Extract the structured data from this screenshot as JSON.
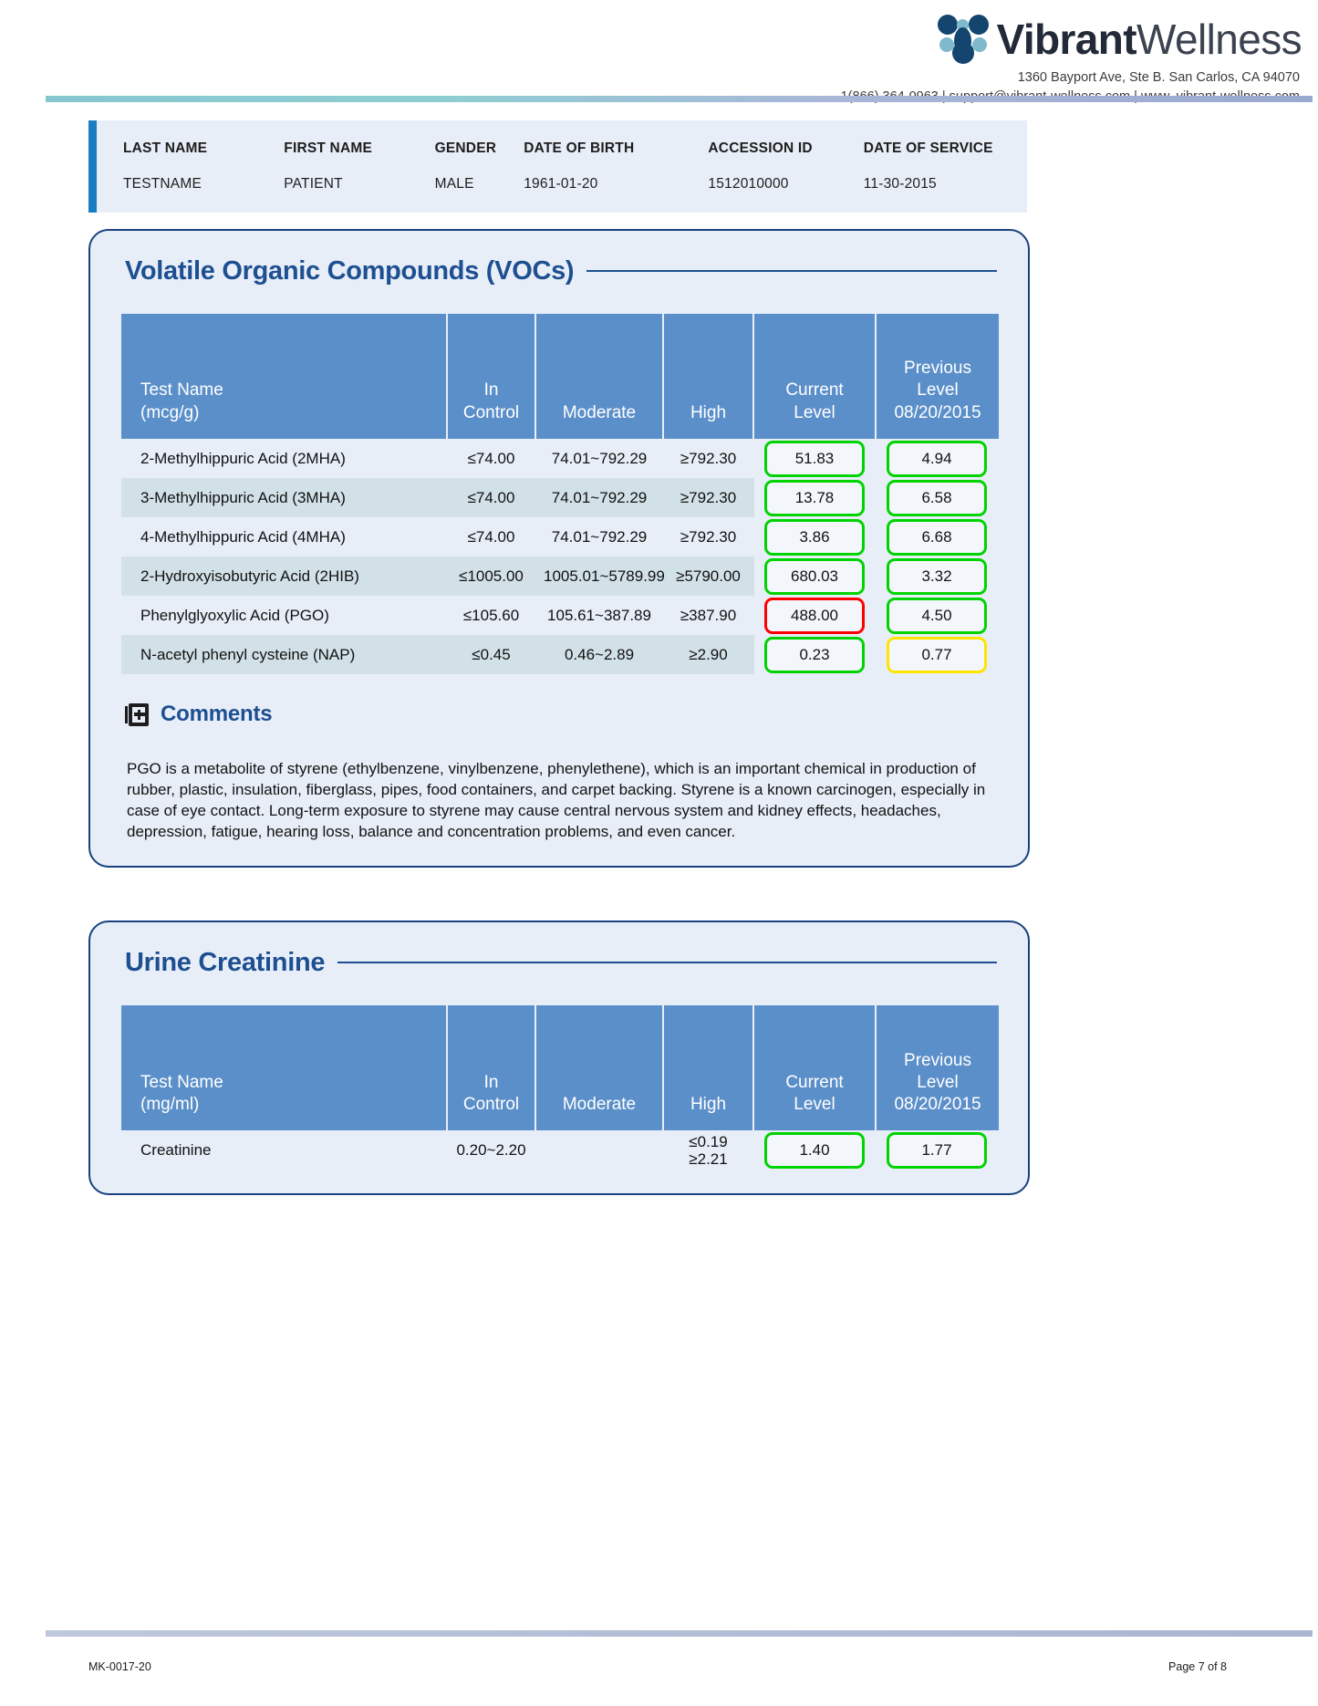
{
  "header": {
    "brand_bold": "Vibrant",
    "brand_light": "Wellness",
    "address_line1": "1360 Bayport Ave, Ste B. San Carlos, CA 94070",
    "address_line2": "1(866) 364-0963 | support@vibrant-wellness.com | www. vibrant-wellness.com"
  },
  "patient": {
    "labels": {
      "last_name": "LAST NAME",
      "first_name": "FIRST NAME",
      "gender": "GENDER",
      "dob": "DATE OF BIRTH",
      "accession_id": "ACCESSION ID",
      "date_of_service": "DATE OF SERVICE"
    },
    "values": {
      "last_name": "TESTNAME",
      "first_name": "PATIENT",
      "gender": "MALE",
      "dob": "1961-01-20",
      "accession_id": "1512010000",
      "date_of_service": "11-30-2015"
    }
  },
  "vocs": {
    "title": "Volatile Organic Compounds (VOCs)",
    "columns": {
      "name_line1": "Test Name",
      "name_line2": "(mcg/g)",
      "in_control_line1": "In",
      "in_control_line2": "Control",
      "moderate": "Moderate",
      "high": "High",
      "current_line1": "Current",
      "current_line2": "Level",
      "previous_line1": "Previous",
      "previous_line2": "Level",
      "previous_line3": "08/20/2015"
    },
    "rows": [
      {
        "name": "2-Methylhippuric Acid (2MHA)",
        "in_control": "≤74.00",
        "moderate": "74.01~792.29",
        "high": "≥792.30",
        "current": "51.83",
        "current_status": "green",
        "previous": "4.94",
        "previous_status": "green"
      },
      {
        "name": "3-Methylhippuric Acid (3MHA)",
        "in_control": "≤74.00",
        "moderate": "74.01~792.29",
        "high": "≥792.30",
        "current": "13.78",
        "current_status": "green",
        "previous": "6.58",
        "previous_status": "green"
      },
      {
        "name": "4-Methylhippuric Acid (4MHA)",
        "in_control": "≤74.00",
        "moderate": "74.01~792.29",
        "high": "≥792.30",
        "current": "3.86",
        "current_status": "green",
        "previous": "6.68",
        "previous_status": "green"
      },
      {
        "name": "2-Hydroxyisobutyric Acid (2HIB)",
        "in_control": "≤1005.00",
        "moderate": "1005.01~5789.99",
        "high": "≥5790.00",
        "current": "680.03",
        "current_status": "green",
        "previous": "3.32",
        "previous_status": "green"
      },
      {
        "name": "Phenylglyoxylic Acid (PGO)",
        "in_control": "≤105.60",
        "moderate": "105.61~387.89",
        "high": "≥387.90",
        "current": "488.00",
        "current_status": "red",
        "previous": "4.50",
        "previous_status": "green"
      },
      {
        "name": "N-acetyl phenyl cysteine (NAP)",
        "in_control": "≤0.45",
        "moderate": "0.46~2.89",
        "high": "≥2.90",
        "current": "0.23",
        "current_status": "green",
        "previous": "0.77",
        "previous_status": "yellow"
      }
    ],
    "comments_title": "Comments",
    "comments_text": "PGO is a metabolite of styrene (ethylbenzene, vinylbenzene, phenylethene), which is an important chemical in production of rubber, plastic, insulation, fiberglass, pipes, food containers, and carpet backing.  Styrene is a known carcinogen, especially in case of eye contact. Long-term exposure to styrene may cause central nervous system and kidney effects, headaches, depression, fatigue, hearing loss, balance and concentration problems, and even cancer."
  },
  "creatinine": {
    "title": "Urine Creatinine",
    "columns": {
      "name_line1": "Test Name",
      "name_line2": "(mg/ml)",
      "in_control_line1": "In",
      "in_control_line2": "Control",
      "moderate": "Moderate",
      "high": "High",
      "current_line1": "Current",
      "current_line2": "Level",
      "previous_line1": "Previous",
      "previous_line2": "Level",
      "previous_line3": "08/20/2015"
    },
    "rows": [
      {
        "name": "Creatinine",
        "in_control": "0.20~2.20",
        "moderate": "",
        "high_line1": "≤0.19",
        "high_line2": "≥2.21",
        "current": "1.40",
        "current_status": "green",
        "previous": "1.77",
        "previous_status": "green"
      }
    ]
  },
  "footer": {
    "doc_code": "MK-0017-20",
    "page": "Page 7 of 8"
  },
  "colors": {
    "brand_blue": "#1d4f91",
    "panel_border": "#18427e",
    "table_header": "#5b8fc9",
    "status_green": "#00d400",
    "status_red": "#ff0000",
    "status_yellow": "#ffe400"
  }
}
